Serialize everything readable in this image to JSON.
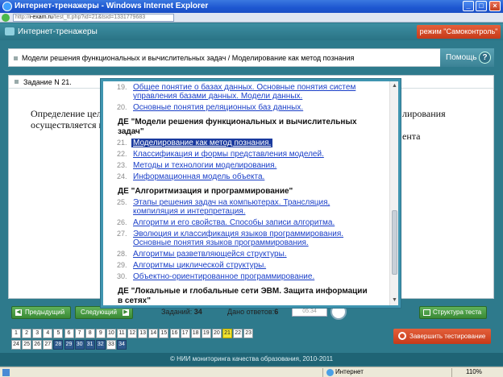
{
  "window": {
    "title": "Интернет-тренажеры - Windows Internet Explorer",
    "url_prefix": "http://",
    "url_domain": "i-exam.ru",
    "url_path": "/test_tt.php?id=21&tsid=1331779683"
  },
  "app": {
    "title": "Интернет-тренажеры",
    "mode_label": "режим \"Самоконтроль\"",
    "topic": "Модели решения функциональных и вычислительных задач / Моделирование как метод познания",
    "help_label": "Помощь",
    "help_icon": "?"
  },
  "task": {
    "header": "Задание N 21.",
    "text_line1_start": "Определение целе",
    "text_line1_end": "лирования",
    "text_line2_start": "осуществляется н",
    "text_line2_end": "ента"
  },
  "popup": {
    "items": [
      {
        "kind": "item",
        "num": "19.",
        "lines": [
          "Общее понятие о базах данных. Основные понятия систем",
          "управления базами данных. Модели данных."
        ]
      },
      {
        "kind": "item",
        "num": "20.",
        "lines": [
          "Основные понятия реляционных баз данных."
        ]
      },
      {
        "kind": "head",
        "lines": [
          "ДЕ \"Модели решения функциональных и вычислительных",
          "задач\""
        ]
      },
      {
        "kind": "item",
        "num": "21.",
        "lines": [
          "Моделирование как метод познания."
        ],
        "selected": true
      },
      {
        "kind": "item",
        "num": "22.",
        "lines": [
          "Классификация и формы представления моделей."
        ]
      },
      {
        "kind": "item",
        "num": "23.",
        "lines": [
          "Методы и технологии моделирования."
        ]
      },
      {
        "kind": "item",
        "num": "24.",
        "lines": [
          "Информационная модель объекта."
        ]
      },
      {
        "kind": "head",
        "lines": [
          "ДЕ \"Алгоритмизация и программирование\""
        ]
      },
      {
        "kind": "item",
        "num": "25.",
        "lines": [
          "Этапы решения задач на компьютерах. Трансляция,",
          "компиляция и интерпретация."
        ]
      },
      {
        "kind": "item",
        "num": "26.",
        "lines": [
          "Алгоритм и его свойства. Способы записи алгоритма."
        ]
      },
      {
        "kind": "item",
        "num": "27.",
        "lines": [
          "Эволюция и классификация языков программирования.",
          "Основные понятия языков программирования."
        ]
      },
      {
        "kind": "item",
        "num": "28.",
        "lines": [
          "Алгоритмы разветвляющейся структуры."
        ]
      },
      {
        "kind": "item",
        "num": "29.",
        "lines": [
          "Алгоритмы циклической структуры."
        ]
      },
      {
        "kind": "item",
        "num": "30.",
        "lines": [
          "Объектно-ориентированное программирование."
        ]
      },
      {
        "kind": "head",
        "lines": [
          "ДЕ \"Локальные и глобальные сети ЭВМ. Защита информации",
          "в сетях\""
        ]
      }
    ]
  },
  "nav": {
    "prev_label": "Предыдущий",
    "next_label": "Следующий",
    "tasks_label": "Заданий:",
    "tasks_count": "34",
    "answers_label": "Дано ответов:",
    "answers_count": "6",
    "timer": "05:34",
    "structure_label": "Структура теста",
    "finish_label": "Завершить тестирование"
  },
  "question_numbers": {
    "row1": [
      "1",
      "2",
      "3",
      "4",
      "5",
      "6",
      "7",
      "8",
      "9",
      "10",
      "11",
      "12",
      "13",
      "14",
      "15",
      "16",
      "17",
      "18",
      "19",
      "20",
      "21",
      "22",
      "23"
    ],
    "row2": [
      "24",
      "25",
      "26",
      "27",
      "28",
      "29",
      "30",
      "31",
      "32",
      "33",
      "34"
    ],
    "current": "21",
    "answered": [
      "28",
      "29",
      "30",
      "31",
      "32",
      "34"
    ]
  },
  "footer": "© НИИ мониторинга качества образования, 2010-2011",
  "status": {
    "zone": "Интернет",
    "zoom": "110%"
  },
  "colors": {
    "header_teal": "#2a7385",
    "mode_red": "#c63a1a",
    "nav_green": "#3a8a35",
    "current_yellow": "#f1e431",
    "answered_blue": "#2e5a8e",
    "link_blue": "#1a3fc8"
  }
}
